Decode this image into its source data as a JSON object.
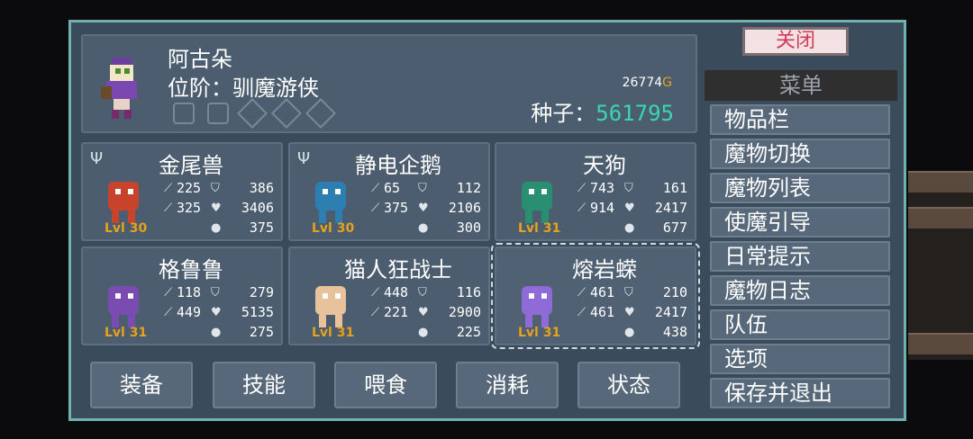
{
  "hero": {
    "name": "阿古朵",
    "rank": "位阶：驯魔游侠",
    "gold": "26774",
    "gold_symbol": "G",
    "seeds_label": "种子：",
    "seeds_value": "561795"
  },
  "monsters": [
    {
      "name": "金尾兽",
      "level": "Lvl 30",
      "attack": "225",
      "defense": "386",
      "magic": "325",
      "health": "3406",
      "mana": "375",
      "has_fork": true,
      "color": "#c8432c"
    },
    {
      "name": "静电企鹅",
      "level": "Lvl 30",
      "attack": "65",
      "defense": "112",
      "magic": "375",
      "health": "2106",
      "mana": "300",
      "has_fork": true,
      "color": "#2c7fb0"
    },
    {
      "name": "天狗",
      "level": "Lvl 31",
      "attack": "743",
      "defense": "161",
      "magic": "914",
      "health": "2417",
      "mana": "677",
      "has_fork": false,
      "color": "#2a8f70"
    },
    {
      "name": "格鲁鲁",
      "level": "Lvl 31",
      "attack": "118",
      "defense": "279",
      "magic": "449",
      "health": "5135",
      "mana": "275",
      "has_fork": false,
      "color": "#7a4bb0"
    },
    {
      "name": "猫人狂战士",
      "level": "Lvl 31",
      "attack": "448",
      "defense": "116",
      "magic": "221",
      "health": "2900",
      "mana": "225",
      "has_fork": false,
      "color": "#e8c29a"
    },
    {
      "name": "熔岩蝾",
      "level": "Lvl 31",
      "attack": "461",
      "defense": "210",
      "magic": "461",
      "health": "2417",
      "mana": "438",
      "has_fork": false,
      "color": "#8e6bd6"
    }
  ],
  "bottom_buttons": [
    "装备",
    "技能",
    "喂食",
    "消耗",
    "状态"
  ],
  "close_label": "关闭",
  "menu": {
    "title": "菜单",
    "items": [
      "物品栏",
      "魔物切换",
      "魔物列表",
      "使魔引导",
      "日常提示",
      "魔物日志",
      "队伍",
      "选项",
      "保存并退出"
    ]
  }
}
